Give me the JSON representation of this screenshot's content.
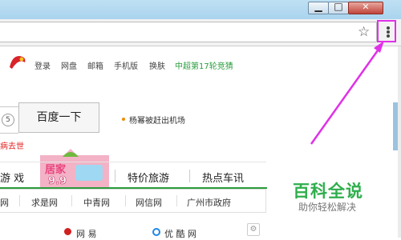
{
  "window": {
    "minimize_label": "▁",
    "maximize_label": "□",
    "close_label": "✕"
  },
  "toolbar": {
    "star_icon": "star-icon",
    "menu_icon": "vertical-dots-icon"
  },
  "nav": {
    "items": [
      "登录",
      "网盘",
      "邮箱",
      "手机版",
      "换肤"
    ],
    "special": "中超第17轮竞猜"
  },
  "search": {
    "badge": "5",
    "button_label": "百度一下"
  },
  "hot": {
    "text": "杨幂被赶出机场"
  },
  "news_red": "病去世",
  "promo": {
    "title": "居家",
    "subtitle": "9.9"
  },
  "categories": [
    "游 戏",
    "特价旅游",
    "热点车讯"
  ],
  "sites": [
    "网",
    "求是网",
    "中青网",
    "网信网",
    "广州市政府"
  ],
  "bottom": {
    "item1": "网 易",
    "item2": "优 酷 网"
  },
  "watermark": {
    "title": "百科全说",
    "subtitle": "助你轻松解决"
  },
  "colors": {
    "highlight": "#e030e8",
    "brand_green": "#2fae4c"
  }
}
